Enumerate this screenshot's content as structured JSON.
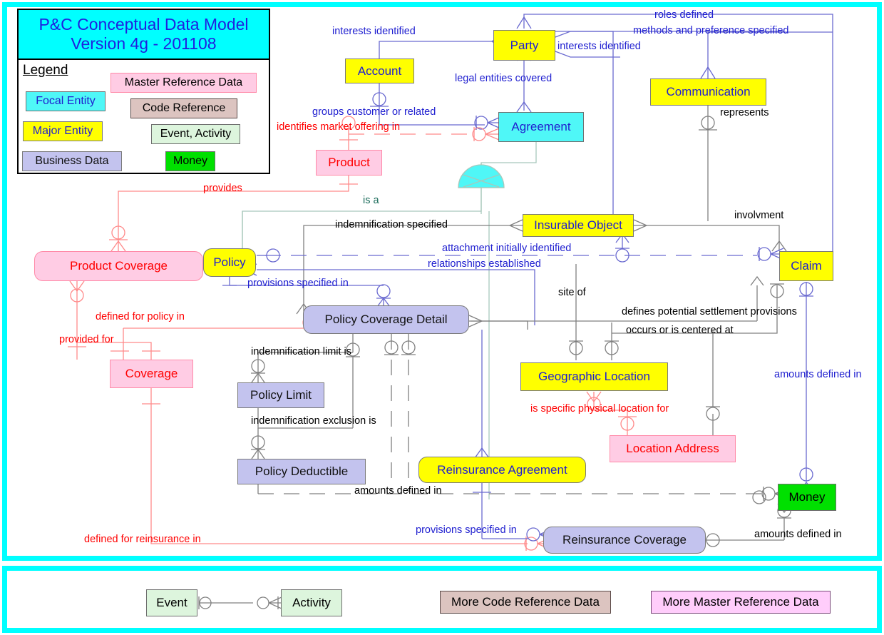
{
  "title_block": {
    "line1": "P&C Conceptual Data Model",
    "line2": "Version 4g - 201108",
    "legend_heading": "Legend",
    "legend_items": [
      {
        "label": "Focal Entity",
        "kind": "focal"
      },
      {
        "label": "Major Entity",
        "kind": "major"
      },
      {
        "label": "Business Data",
        "kind": "biz"
      },
      {
        "label": "Master Reference Data",
        "kind": "master"
      },
      {
        "label": "Code Reference",
        "kind": "code"
      },
      {
        "label": "Event, Activity",
        "kind": "event"
      },
      {
        "label": "Money",
        "kind": "money"
      }
    ]
  },
  "entities": [
    {
      "id": "party",
      "label": "Party",
      "kind": "major"
    },
    {
      "id": "account",
      "label": "Account",
      "kind": "major"
    },
    {
      "id": "communication",
      "label": "Communication",
      "kind": "major"
    },
    {
      "id": "agreement",
      "label": "Agreement",
      "kind": "focal"
    },
    {
      "id": "product",
      "label": "Product",
      "kind": "master"
    },
    {
      "id": "product_coverage",
      "label": "Product Coverage",
      "kind": "master"
    },
    {
      "id": "coverage",
      "label": "Coverage",
      "kind": "master"
    },
    {
      "id": "policy",
      "label": "Policy",
      "kind": "major"
    },
    {
      "id": "insurable_object",
      "label": "Insurable Object",
      "kind": "major"
    },
    {
      "id": "claim",
      "label": "Claim",
      "kind": "major"
    },
    {
      "id": "pcd",
      "label": "Policy Coverage Detail",
      "kind": "biz"
    },
    {
      "id": "policy_limit",
      "label": "Policy Limit",
      "kind": "biz"
    },
    {
      "id": "policy_deductible",
      "label": "Policy Deductible",
      "kind": "biz"
    },
    {
      "id": "geo_location",
      "label": "Geographic Location",
      "kind": "major"
    },
    {
      "id": "location_address",
      "label": "Location Address",
      "kind": "master"
    },
    {
      "id": "reins_agreement",
      "label": "Reinsurance Agreement",
      "kind": "major"
    },
    {
      "id": "reins_coverage",
      "label": "Reinsurance Coverage",
      "kind": "biz"
    },
    {
      "id": "money",
      "label": "Money",
      "kind": "money"
    }
  ],
  "relationship_labels": [
    {
      "id": "r01",
      "text": "interests identified",
      "color": "blue"
    },
    {
      "id": "r02",
      "text": "roles defined",
      "color": "blue"
    },
    {
      "id": "r03",
      "text": "methods and preference specified",
      "color": "blue"
    },
    {
      "id": "r04",
      "text": "interests identified",
      "color": "blue"
    },
    {
      "id": "r05",
      "text": "legal entities covered",
      "color": "blue"
    },
    {
      "id": "r06",
      "text": "represents",
      "color": "blk"
    },
    {
      "id": "r07",
      "text": "groups customer or related",
      "color": "blue"
    },
    {
      "id": "r08",
      "text": "identifies market offering in",
      "color": "red"
    },
    {
      "id": "r09",
      "text": "provides",
      "color": "red"
    },
    {
      "id": "r10",
      "text": "is a",
      "color": "grn"
    },
    {
      "id": "r11",
      "text": "indemnification specified",
      "color": "blk"
    },
    {
      "id": "r12",
      "text": "attachment initially identified",
      "color": "blue"
    },
    {
      "id": "r13",
      "text": "relationships established",
      "color": "blue"
    },
    {
      "id": "r14",
      "text": "provisions specified in",
      "color": "blue"
    },
    {
      "id": "r15",
      "text": "involvment",
      "color": "blk"
    },
    {
      "id": "r16",
      "text": "site of",
      "color": "blk"
    },
    {
      "id": "r17",
      "text": "defines potential settlement provisions",
      "color": "blk"
    },
    {
      "id": "r18",
      "text": "occurs or is centered at",
      "color": "blk"
    },
    {
      "id": "r19",
      "text": "defined for policy in",
      "color": "red"
    },
    {
      "id": "r20",
      "text": "provided for",
      "color": "red"
    },
    {
      "id": "r21",
      "text": "indemnification limit is",
      "color": "blk"
    },
    {
      "id": "r22",
      "text": "indemnification exclusion is",
      "color": "blk"
    },
    {
      "id": "r23",
      "text": "is specific physical location for",
      "color": "red"
    },
    {
      "id": "r24",
      "text": "amounts defined in",
      "color": "blue"
    },
    {
      "id": "r25",
      "text": "amounts defined in",
      "color": "blk"
    },
    {
      "id": "r26",
      "text": "amounts defined in",
      "color": "blk"
    },
    {
      "id": "r27",
      "text": "provisions specified in",
      "color": "blue"
    },
    {
      "id": "r28",
      "text": "defined for reinsurance in",
      "color": "red"
    }
  ],
  "footer": {
    "event_label": "Event",
    "activity_label": "Activity",
    "more_code_reference": "More Code Reference Data",
    "more_master_reference": "More Master Reference Data"
  },
  "colors": {
    "frame": "#00ffff",
    "focal": "#4ff7f7",
    "major": "#ffff00",
    "business": "#c3c3ee",
    "master_reference": "#ffcce4",
    "code_reference": "#dcc4c0",
    "event_activity": "#ddf5dd",
    "money": "#00e000",
    "blue_line": "#6a6ad0",
    "red_line": "#ff8080",
    "black_line": "#808080",
    "green_line": "#a8c8bc"
  }
}
